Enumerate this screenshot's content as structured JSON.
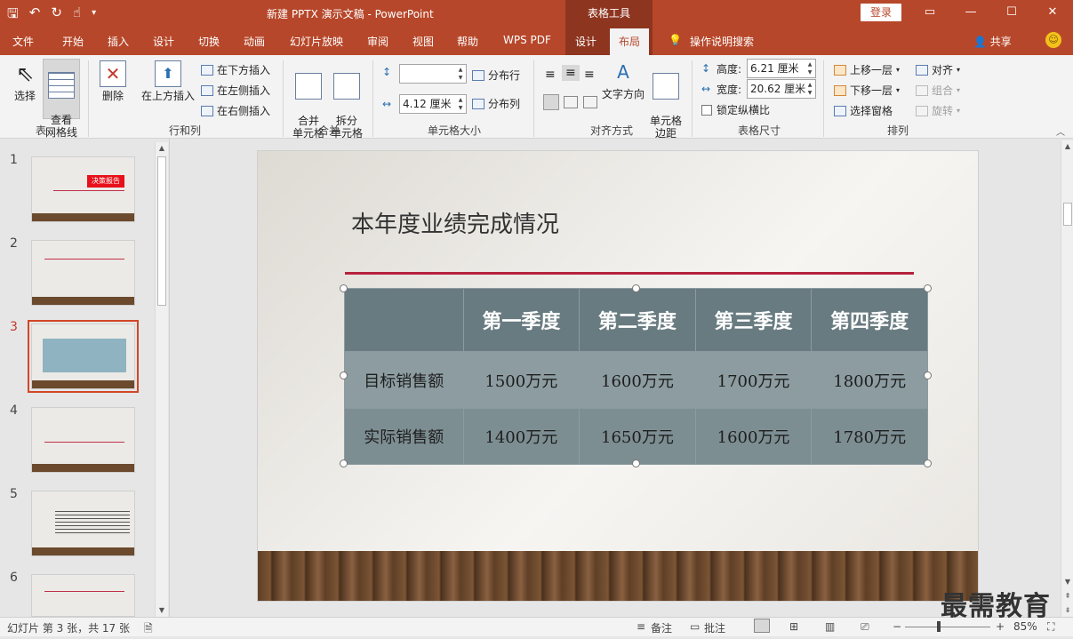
{
  "title_bar": {
    "document_title": "新建 PPTX 演示文稿  -  PowerPoint",
    "context_tool": "表格工具",
    "login_label": "登录",
    "icons": [
      "save-icon",
      "undo-icon",
      "redo-icon",
      "touch-mode-icon",
      "customize-qat-icon"
    ]
  },
  "tabs": [
    {
      "label": "文件"
    },
    {
      "label": "开始"
    },
    {
      "label": "插入"
    },
    {
      "label": "设计"
    },
    {
      "label": "切换"
    },
    {
      "label": "动画"
    },
    {
      "label": "幻灯片放映"
    },
    {
      "label": "审阅"
    },
    {
      "label": "视图"
    },
    {
      "label": "帮助"
    },
    {
      "label": "WPS PDF"
    },
    {
      "label": "设计"
    },
    {
      "label": "布局"
    }
  ],
  "active_tab": "布局",
  "tell_me": "操作说明搜索",
  "share_label": "共享",
  "ribbon": {
    "table_group": {
      "label": "表",
      "select": "选择",
      "view_gridlines": "查看\n网格线"
    },
    "rows_cols_group": {
      "label": "行和列",
      "delete": "删除",
      "insert_above": "在上方插入",
      "insert_below": "在下方插入",
      "insert_left": "在左侧插入",
      "insert_right": "在右侧插入"
    },
    "merge_group": {
      "label": "合并",
      "merge_cells": "合并\n单元格",
      "split_cells": "拆分\n单元格"
    },
    "cell_size_group": {
      "label": "单元格大小",
      "height_value": "",
      "width_value": "4.12 厘米",
      "distribute_rows": "分布行",
      "distribute_cols": "分布列"
    },
    "alignment_group": {
      "label": "对齐方式",
      "text_direction": "文字方向",
      "cell_margins": "单元格\n边距"
    },
    "table_size_group": {
      "label": "表格尺寸",
      "height_label": "高度:",
      "height_value": "6.21 厘米",
      "width_label": "宽度:",
      "width_value": "20.62 厘米",
      "lock_ratio": "锁定纵横比"
    },
    "arrange_group": {
      "label": "排列",
      "bring_forward": "上移一层",
      "send_backward": "下移一层",
      "selection_pane": "选择窗格",
      "align": "对齐",
      "group": "组合",
      "rotate": "旋转"
    }
  },
  "thumbnails": [
    {
      "number": "1",
      "label": "决策报告"
    },
    {
      "number": "2"
    },
    {
      "number": "3",
      "selected": true
    },
    {
      "number": "4"
    },
    {
      "number": "5"
    },
    {
      "number": "6"
    }
  ],
  "slide": {
    "title": "本年度业绩完成情况",
    "table": {
      "headers": [
        "",
        "第一季度",
        "第二季度",
        "第三季度",
        "第四季度"
      ],
      "rows": [
        [
          "目标销售额",
          "1500万元",
          "1600万元",
          "1700万元",
          "1800万元"
        ],
        [
          "实际销售额",
          "1400万元",
          "1650万元",
          "1600万元",
          "1780万元"
        ]
      ]
    }
  },
  "status_bar": {
    "slide_info": "幻灯片 第 3 张，共 17 张",
    "notes": "备注",
    "comments": "批注",
    "zoom": "85%"
  },
  "watermark": "最需教育",
  "colors": {
    "accent": "#b7472a",
    "context_tab": "#8e3520",
    "table_header": "#687b80",
    "title_rule": "#b5223d"
  }
}
